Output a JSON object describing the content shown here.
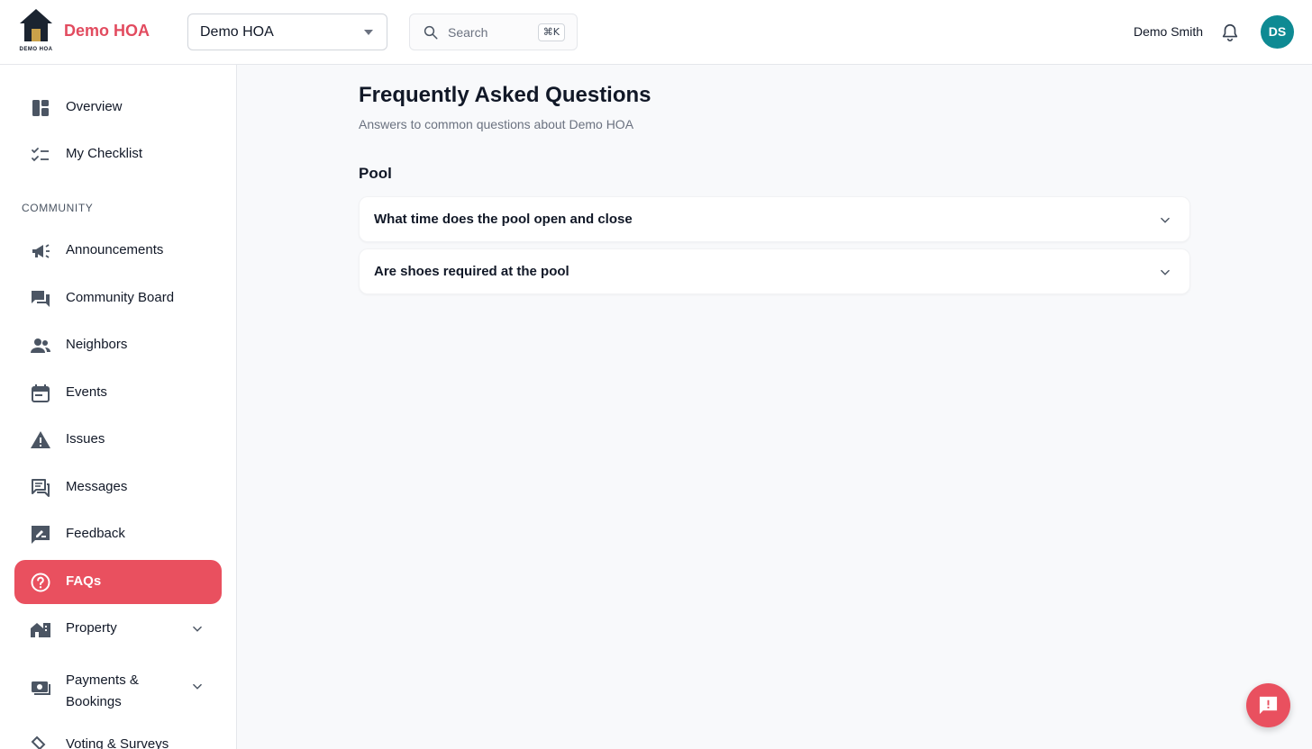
{
  "header": {
    "logo_text": "DEMO HOA",
    "brand": "Demo HOA",
    "org_select_value": "Demo HOA",
    "search_placeholder": "Search",
    "search_shortcut": "⌘K",
    "user_name": "Demo Smith",
    "avatar_initials": "DS"
  },
  "sidebar": {
    "top_items": [
      {
        "label": "Overview",
        "icon": "dashboard-icon"
      },
      {
        "label": "My Checklist",
        "icon": "checklist-icon"
      }
    ],
    "section_label": "COMMUNITY",
    "items": [
      {
        "label": "Announcements",
        "icon": "megaphone-icon"
      },
      {
        "label": "Community Board",
        "icon": "forum-icon"
      },
      {
        "label": "Neighbors",
        "icon": "people-icon"
      },
      {
        "label": "Events",
        "icon": "calendar-icon"
      },
      {
        "label": "Issues",
        "icon": "warning-icon"
      },
      {
        "label": "Messages",
        "icon": "messages-icon"
      },
      {
        "label": "Feedback",
        "icon": "feedback-icon"
      },
      {
        "label": "FAQs",
        "icon": "help-circle-icon",
        "active": true
      },
      {
        "label": "Property",
        "icon": "property-icon",
        "expandable": true
      },
      {
        "label": "Payments & Bookings",
        "icon": "payments-icon",
        "expandable": true
      },
      {
        "label": "Voting & Surveys",
        "icon": "vote-icon"
      }
    ]
  },
  "main": {
    "title": "Frequently Asked Questions",
    "subtitle": "Answers to common questions about Demo HOA",
    "groups": [
      {
        "title": "Pool",
        "questions": [
          "What time does the pool open and close",
          "Are shoes required at the pool"
        ]
      }
    ]
  },
  "colors": {
    "accent": "#e9505f",
    "brand_text": "#e24b5f",
    "avatar": "#0e8a93",
    "icon": "#4b5563"
  }
}
